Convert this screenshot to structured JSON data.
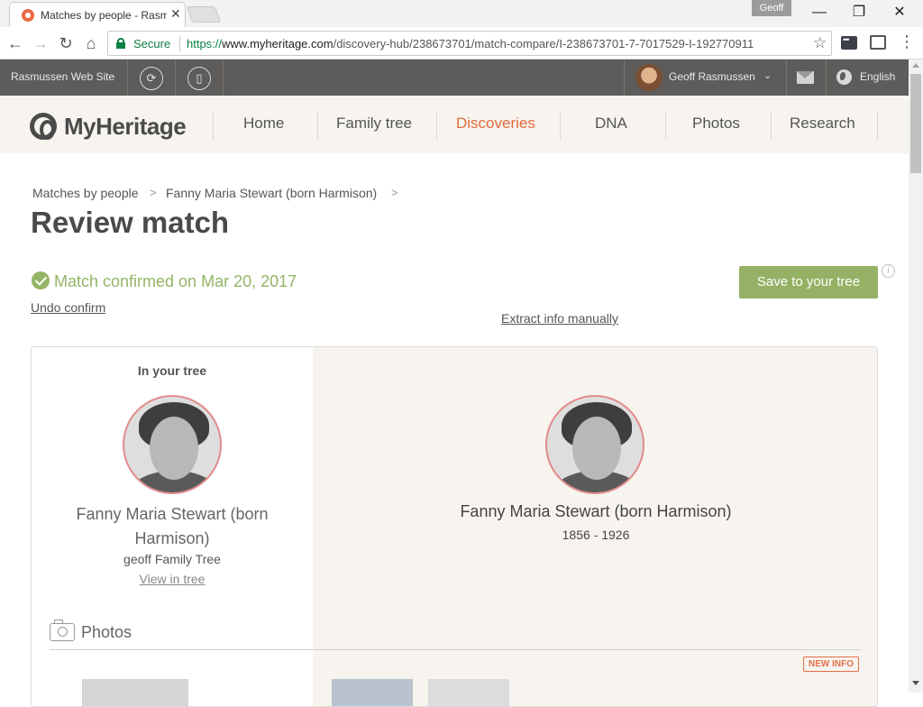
{
  "browser": {
    "tab_title": "Matches by people - Rasmussen Web Site",
    "profile": "Geoff",
    "secure_label": "Secure",
    "url_scheme": "https://",
    "url_host": "www.myheritage.com",
    "url_path": "/discovery-hub/238673701/match-compare/I-238673701-7-7017529-I-192770911"
  },
  "site_bar": {
    "site_name": "Rasmussen Web Site",
    "user_name": "Geoff Rasmussen",
    "language": "English"
  },
  "nav": {
    "logo": "MyHeritage",
    "items": [
      "Home",
      "Family tree",
      "Discoveries",
      "DNA",
      "Photos",
      "Research"
    ],
    "active": "Discoveries",
    "active_color": "#e26b3e"
  },
  "breadcrumb": [
    "Matches by people",
    "Fanny Maria Stewart (born Harmison)"
  ],
  "page": {
    "title": "Review match",
    "confirmed": "Match confirmed on Mar 20, 2017",
    "undo": "Undo confirm",
    "extract": "Extract info manually",
    "save": "Save to your tree",
    "info": "i",
    "confirm_color": "#93b466"
  },
  "compare": {
    "left_header": "In your tree",
    "left_name": "Fanny Maria Stewart (born Harmison)",
    "left_tree": "geoff Family Tree",
    "left_view": "View in tree",
    "right_name": "Fanny Maria Stewart (born Harmison)",
    "right_years": "1856 - 1926",
    "photos": "Photos",
    "new_info": "NEW INFO"
  }
}
